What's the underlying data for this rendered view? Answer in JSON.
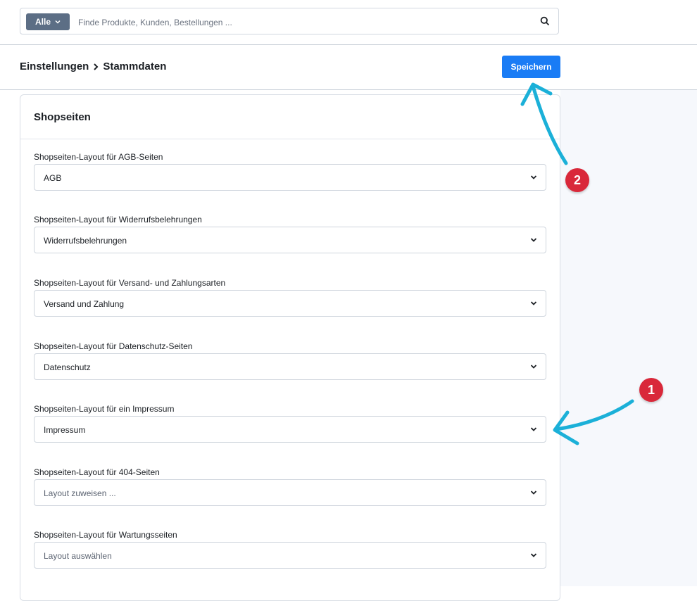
{
  "search": {
    "filter_label": "Alle",
    "placeholder": "Finde Produkte, Kunden, Bestellungen ..."
  },
  "header": {
    "breadcrumb_parent": "Einstellungen",
    "breadcrumb_current": "Stammdaten",
    "save_label": "Speichern"
  },
  "card": {
    "title": "Shopseiten",
    "fields": [
      {
        "label": "Shopseiten-Layout für AGB-Seiten",
        "value": "AGB"
      },
      {
        "label": "Shopseiten-Layout für Widerrufsbelehrungen",
        "value": "Widerrufsbelehrungen"
      },
      {
        "label": "Shopseiten-Layout für Versand- und Zahlungsarten",
        "value": "Versand und Zahlung"
      },
      {
        "label": "Shopseiten-Layout für Datenschutz-Seiten",
        "value": "Datenschutz"
      },
      {
        "label": "Shopseiten-Layout für ein Impressum",
        "value": "Impressum"
      },
      {
        "label": "Shopseiten-Layout für 404-Seiten",
        "value": "Layout zuweisen ..."
      },
      {
        "label": "Shopseiten-Layout für Wartungsseiten",
        "value": "Layout auswählen"
      }
    ]
  },
  "annotations": {
    "badge_1": "1",
    "badge_2": "2",
    "arrow_color": "#1bb0d8",
    "badge_color": "#d9283a"
  },
  "colors": {
    "accent": "#1a7cf5",
    "filter_bg": "#5c6e85"
  }
}
